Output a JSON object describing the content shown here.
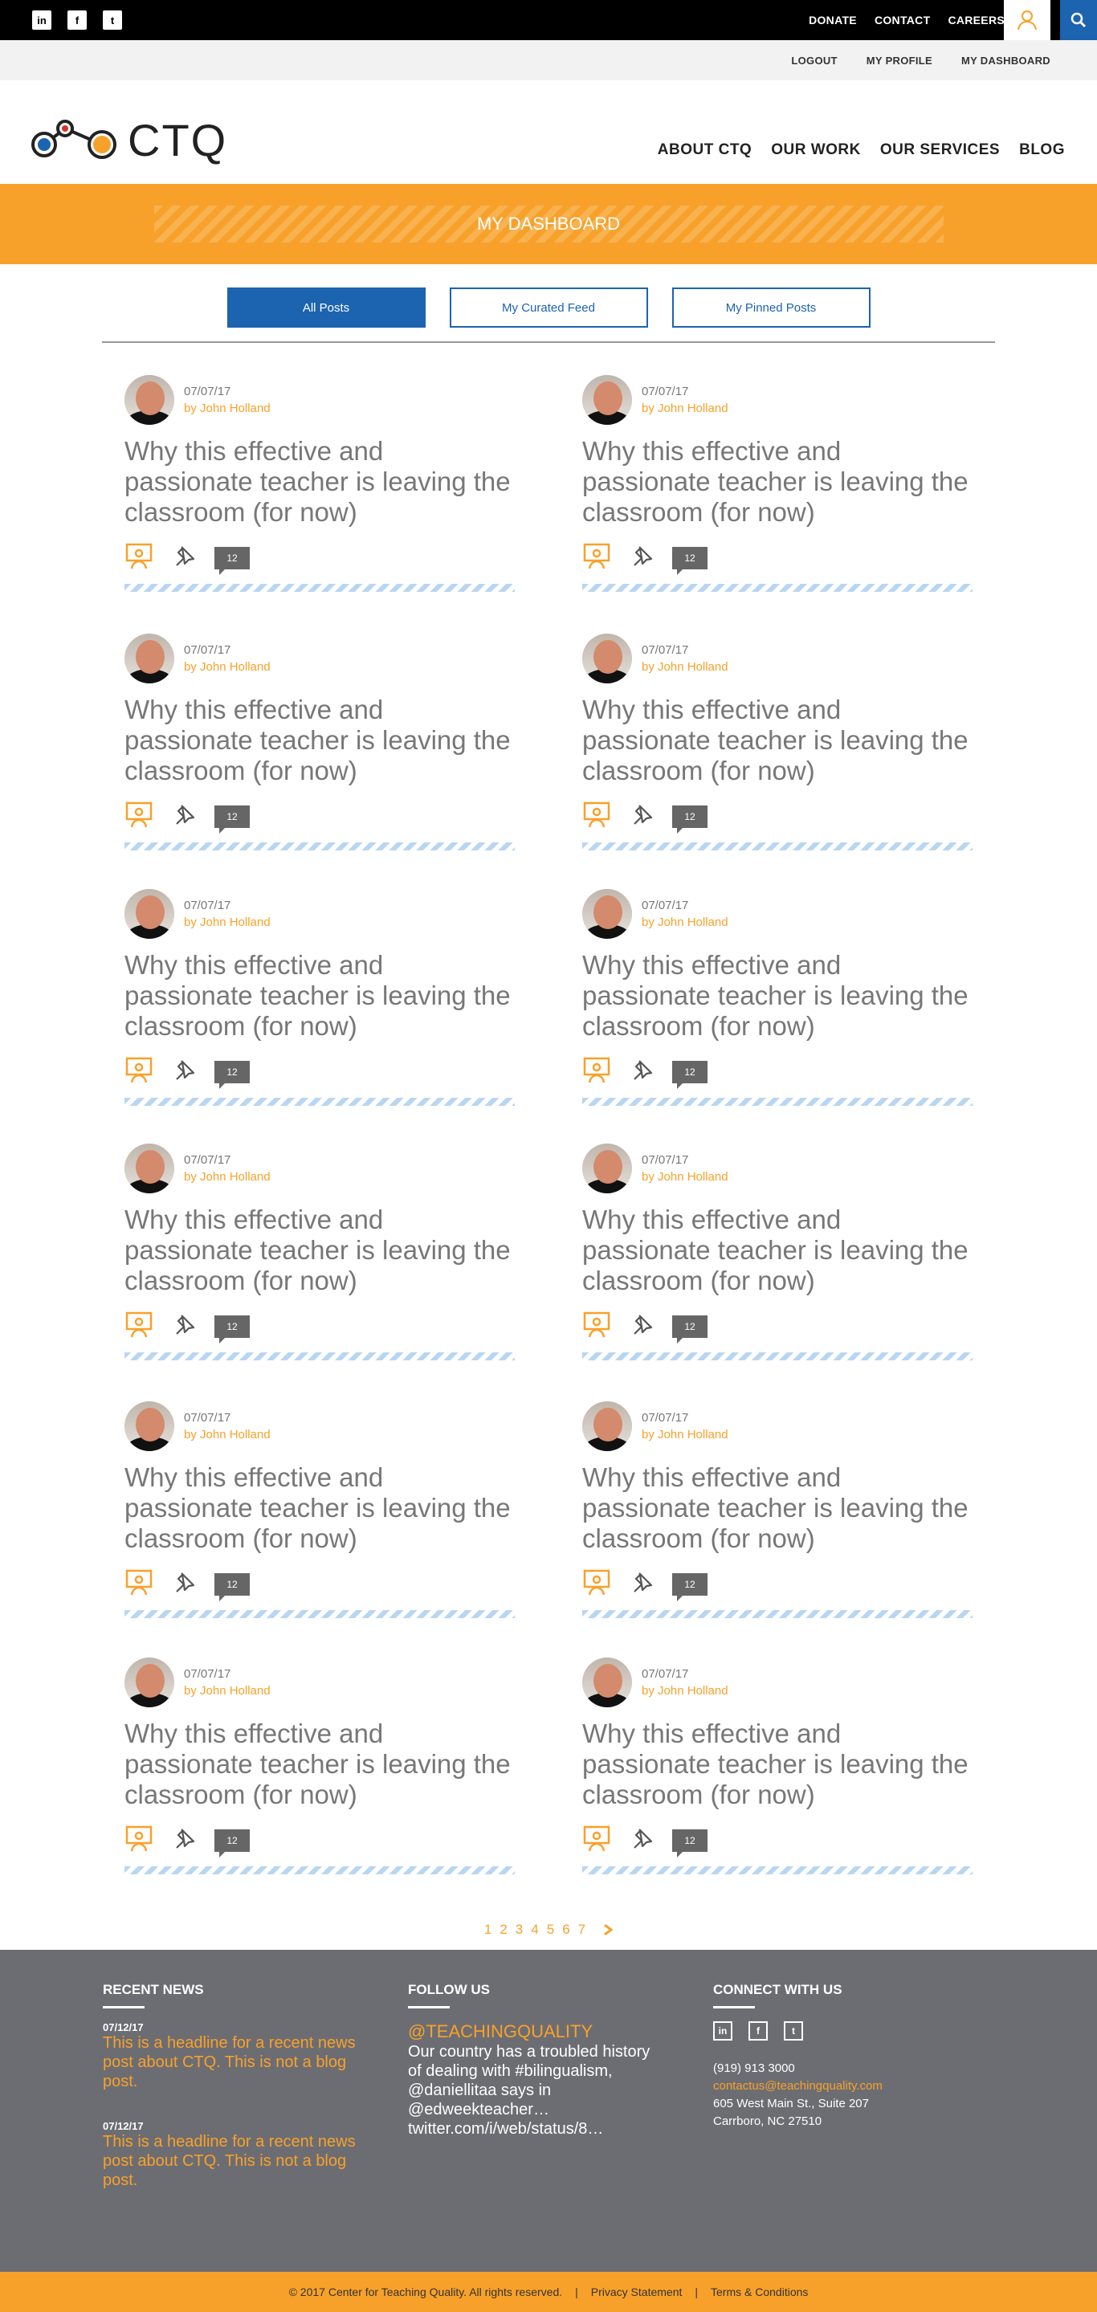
{
  "topbar": {
    "social": [
      "in",
      "f",
      "t"
    ],
    "links": [
      "DONATE",
      "CONTACT",
      "CAREERS"
    ]
  },
  "subbar": {
    "links": [
      "LOGOUT",
      "MY PROFILE",
      "MY DASHBOARD"
    ]
  },
  "header": {
    "logo_text": "CTQ",
    "nav": [
      "ABOUT CTQ",
      "OUR WORK",
      "OUR SERVICES",
      "BLOG"
    ]
  },
  "banner": {
    "title": "MY DASHBOARD"
  },
  "tabs": [
    {
      "label": "All Posts",
      "active": true
    },
    {
      "label": "My Curated Feed",
      "active": false
    },
    {
      "label": "My Pinned Posts",
      "active": false
    }
  ],
  "post": {
    "date": "07/07/17",
    "author": "by John Holland",
    "title": "Why this effective and passionate teacher is leaving the classroom (for now)",
    "comments": "12"
  },
  "pagination": {
    "pages": [
      "1",
      "2",
      "3",
      "4",
      "5",
      "6",
      "7"
    ]
  },
  "footer": {
    "recent_news": {
      "heading": "RECENT NEWS",
      "items": [
        {
          "date": "07/12/17",
          "text": "This is a headline for a recent news post about CTQ. This is not a blog post."
        },
        {
          "date": "07/12/17",
          "text": "This is a headline for a recent news post about CTQ. This is not a blog post."
        }
      ]
    },
    "follow": {
      "heading": "FOLLOW US",
      "handle": "@TEACHINGQUALITY",
      "tweet": "Our country has a troubled history of dealing with #bilingualism, @daniellitaa says in @edweekteacher… twitter.com/i/web/status/8…"
    },
    "connect": {
      "heading": "CONNECT WITH US",
      "social": [
        "in",
        "f",
        "t"
      ],
      "phone": "(919) 913 3000",
      "email": "contactus@teachingquality.com",
      "address1": "605 West Main St., Suite 207",
      "address2": "Carrboro, NC 27510"
    }
  },
  "bottom": {
    "copyright": "© 2017 Center for Teaching Quality. All rights reserved.",
    "sep": "|",
    "privacy": "Privacy Statement",
    "terms": "Terms & Conditions"
  },
  "colors": {
    "accent": "#f8a12a",
    "brand_blue": "#1c63b0",
    "footer_grey": "#6c6d73"
  }
}
